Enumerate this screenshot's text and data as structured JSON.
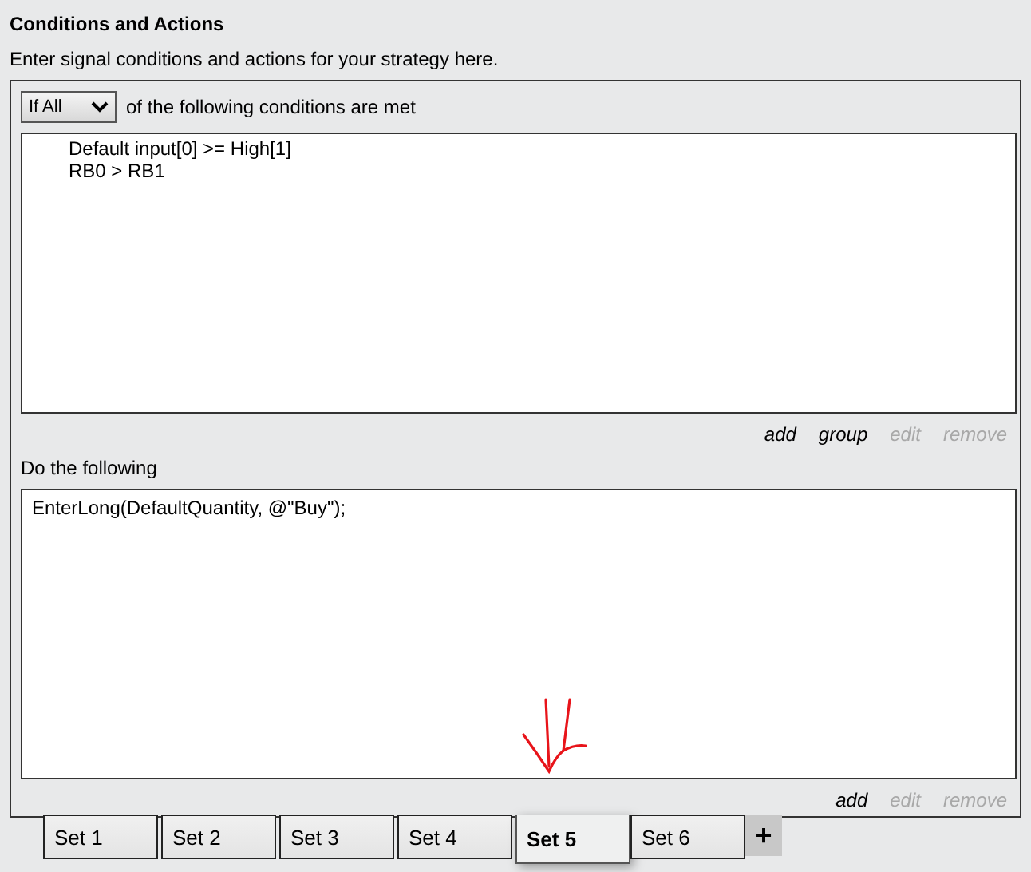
{
  "header": {
    "title": "Conditions and Actions",
    "subtitle": "Enter signal conditions and actions for your strategy here."
  },
  "conditions": {
    "match_select": {
      "value": "If All"
    },
    "match_text": "of the following conditions are met",
    "items": [
      "Default input[0] >= High[1]",
      "RB0 > RB1"
    ],
    "links": [
      {
        "label": "add",
        "disabled": false
      },
      {
        "label": "group",
        "disabled": false
      },
      {
        "label": "edit",
        "disabled": true
      },
      {
        "label": "remove",
        "disabled": true
      }
    ]
  },
  "actions": {
    "heading": "Do the following",
    "items": [
      "EnterLong(DefaultQuantity, @\"Buy\");"
    ],
    "links": [
      {
        "label": "add",
        "disabled": false
      },
      {
        "label": "edit",
        "disabled": true
      },
      {
        "label": "remove",
        "disabled": true
      }
    ]
  },
  "tabs": [
    {
      "label": "Set 1",
      "selected": false
    },
    {
      "label": "Set 2",
      "selected": false
    },
    {
      "label": "Set 3",
      "selected": false
    },
    {
      "label": "Set 4",
      "selected": false
    },
    {
      "label": "Set 5",
      "selected": true
    },
    {
      "label": "Set 6",
      "selected": false
    }
  ],
  "add_tab": {
    "label": "+"
  }
}
